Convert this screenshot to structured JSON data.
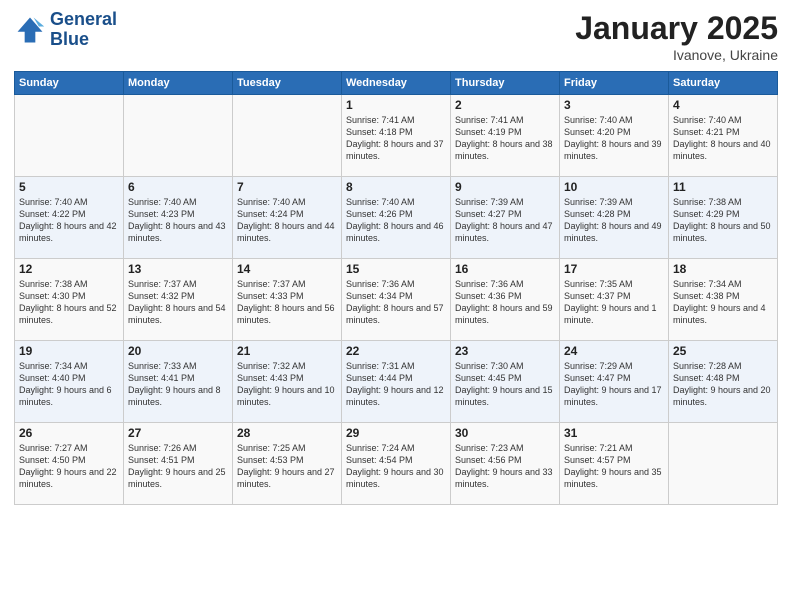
{
  "logo": {
    "line1": "General",
    "line2": "Blue"
  },
  "title": "January 2025",
  "subtitle": "Ivanove, Ukraine",
  "days_header": [
    "Sunday",
    "Monday",
    "Tuesday",
    "Wednesday",
    "Thursday",
    "Friday",
    "Saturday"
  ],
  "weeks": [
    [
      {
        "day": "",
        "text": ""
      },
      {
        "day": "",
        "text": ""
      },
      {
        "day": "",
        "text": ""
      },
      {
        "day": "1",
        "text": "Sunrise: 7:41 AM\nSunset: 4:18 PM\nDaylight: 8 hours and 37 minutes."
      },
      {
        "day": "2",
        "text": "Sunrise: 7:41 AM\nSunset: 4:19 PM\nDaylight: 8 hours and 38 minutes."
      },
      {
        "day": "3",
        "text": "Sunrise: 7:40 AM\nSunset: 4:20 PM\nDaylight: 8 hours and 39 minutes."
      },
      {
        "day": "4",
        "text": "Sunrise: 7:40 AM\nSunset: 4:21 PM\nDaylight: 8 hours and 40 minutes."
      }
    ],
    [
      {
        "day": "5",
        "text": "Sunrise: 7:40 AM\nSunset: 4:22 PM\nDaylight: 8 hours and 42 minutes."
      },
      {
        "day": "6",
        "text": "Sunrise: 7:40 AM\nSunset: 4:23 PM\nDaylight: 8 hours and 43 minutes."
      },
      {
        "day": "7",
        "text": "Sunrise: 7:40 AM\nSunset: 4:24 PM\nDaylight: 8 hours and 44 minutes."
      },
      {
        "day": "8",
        "text": "Sunrise: 7:40 AM\nSunset: 4:26 PM\nDaylight: 8 hours and 46 minutes."
      },
      {
        "day": "9",
        "text": "Sunrise: 7:39 AM\nSunset: 4:27 PM\nDaylight: 8 hours and 47 minutes."
      },
      {
        "day": "10",
        "text": "Sunrise: 7:39 AM\nSunset: 4:28 PM\nDaylight: 8 hours and 49 minutes."
      },
      {
        "day": "11",
        "text": "Sunrise: 7:38 AM\nSunset: 4:29 PM\nDaylight: 8 hours and 50 minutes."
      }
    ],
    [
      {
        "day": "12",
        "text": "Sunrise: 7:38 AM\nSunset: 4:30 PM\nDaylight: 8 hours and 52 minutes."
      },
      {
        "day": "13",
        "text": "Sunrise: 7:37 AM\nSunset: 4:32 PM\nDaylight: 8 hours and 54 minutes."
      },
      {
        "day": "14",
        "text": "Sunrise: 7:37 AM\nSunset: 4:33 PM\nDaylight: 8 hours and 56 minutes."
      },
      {
        "day": "15",
        "text": "Sunrise: 7:36 AM\nSunset: 4:34 PM\nDaylight: 8 hours and 57 minutes."
      },
      {
        "day": "16",
        "text": "Sunrise: 7:36 AM\nSunset: 4:36 PM\nDaylight: 8 hours and 59 minutes."
      },
      {
        "day": "17",
        "text": "Sunrise: 7:35 AM\nSunset: 4:37 PM\nDaylight: 9 hours and 1 minute."
      },
      {
        "day": "18",
        "text": "Sunrise: 7:34 AM\nSunset: 4:38 PM\nDaylight: 9 hours and 4 minutes."
      }
    ],
    [
      {
        "day": "19",
        "text": "Sunrise: 7:34 AM\nSunset: 4:40 PM\nDaylight: 9 hours and 6 minutes."
      },
      {
        "day": "20",
        "text": "Sunrise: 7:33 AM\nSunset: 4:41 PM\nDaylight: 9 hours and 8 minutes."
      },
      {
        "day": "21",
        "text": "Sunrise: 7:32 AM\nSunset: 4:43 PM\nDaylight: 9 hours and 10 minutes."
      },
      {
        "day": "22",
        "text": "Sunrise: 7:31 AM\nSunset: 4:44 PM\nDaylight: 9 hours and 12 minutes."
      },
      {
        "day": "23",
        "text": "Sunrise: 7:30 AM\nSunset: 4:45 PM\nDaylight: 9 hours and 15 minutes."
      },
      {
        "day": "24",
        "text": "Sunrise: 7:29 AM\nSunset: 4:47 PM\nDaylight: 9 hours and 17 minutes."
      },
      {
        "day": "25",
        "text": "Sunrise: 7:28 AM\nSunset: 4:48 PM\nDaylight: 9 hours and 20 minutes."
      }
    ],
    [
      {
        "day": "26",
        "text": "Sunrise: 7:27 AM\nSunset: 4:50 PM\nDaylight: 9 hours and 22 minutes."
      },
      {
        "day": "27",
        "text": "Sunrise: 7:26 AM\nSunset: 4:51 PM\nDaylight: 9 hours and 25 minutes."
      },
      {
        "day": "28",
        "text": "Sunrise: 7:25 AM\nSunset: 4:53 PM\nDaylight: 9 hours and 27 minutes."
      },
      {
        "day": "29",
        "text": "Sunrise: 7:24 AM\nSunset: 4:54 PM\nDaylight: 9 hours and 30 minutes."
      },
      {
        "day": "30",
        "text": "Sunrise: 7:23 AM\nSunset: 4:56 PM\nDaylight: 9 hours and 33 minutes."
      },
      {
        "day": "31",
        "text": "Sunrise: 7:21 AM\nSunset: 4:57 PM\nDaylight: 9 hours and 35 minutes."
      },
      {
        "day": "",
        "text": ""
      }
    ]
  ]
}
